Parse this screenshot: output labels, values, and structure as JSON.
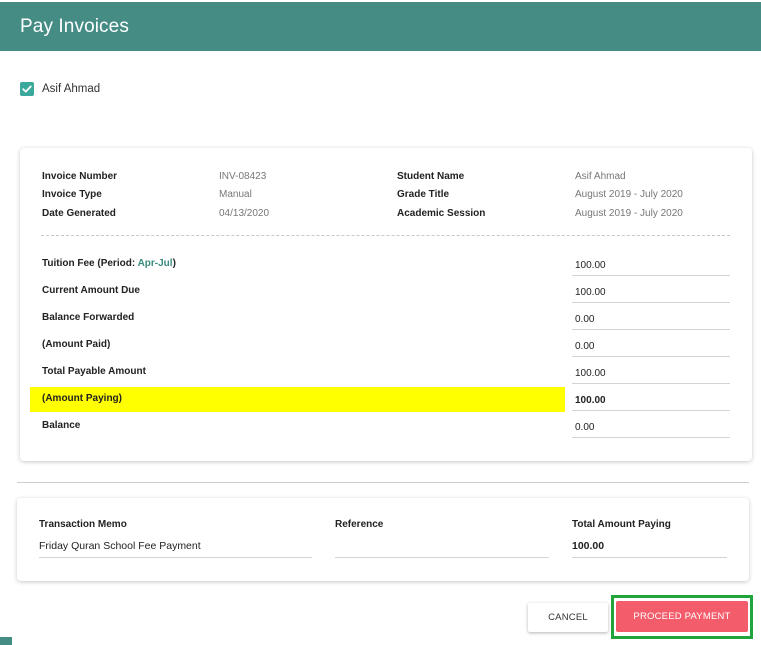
{
  "header": {
    "title": "Pay Invoices"
  },
  "student_checkbox": {
    "checked": true,
    "label": "Asif Ahmad"
  },
  "invoice_info": {
    "invoice_number_label": "Invoice Number",
    "invoice_number": "INV-08423",
    "invoice_type_label": "Invoice Type",
    "invoice_type": "Manual",
    "date_generated_label": "Date Generated",
    "date_generated": "04/13/2020",
    "student_name_label": "Student Name",
    "student_name": "Asif Ahmad",
    "grade_title_label": "Grade Title",
    "grade_title": "August 2019 - July 2020",
    "academic_session_label": "Academic Session",
    "academic_session": "August 2019 - July 2020"
  },
  "amounts": {
    "tuition_fee_label": "Tuition Fee (Period: ",
    "tuition_fee_period": "Apr-Jul",
    "tuition_fee_close": ")",
    "tuition_fee": "100.00",
    "current_amount_due_label": "Current Amount Due",
    "current_amount_due": "100.00",
    "balance_forwarded_label": "Balance Forwarded",
    "balance_forwarded": "0.00",
    "amount_paid_label": "(Amount Paid)",
    "amount_paid": "0.00",
    "total_payable_label": "Total Payable Amount",
    "total_payable": "100.00",
    "amount_paying_label": "(Amount Paying)",
    "amount_paying": "100.00",
    "balance_label": "Balance",
    "balance": "0.00"
  },
  "transaction": {
    "memo_label": "Transaction Memo",
    "memo": "Friday Quran School Fee Payment",
    "reference_label": "Reference",
    "reference": "",
    "total_paying_label": "Total Amount Paying",
    "total_paying": "100.00"
  },
  "actions": {
    "cancel_label": "CANCEL",
    "proceed_label": "PROCEED PAYMENT"
  },
  "colors": {
    "header": "#458c85",
    "checkbox": "#3aa89b",
    "highlight": "#ffff00",
    "proceed": "#f25c6b",
    "proceed_outline": "#1fa53b"
  }
}
